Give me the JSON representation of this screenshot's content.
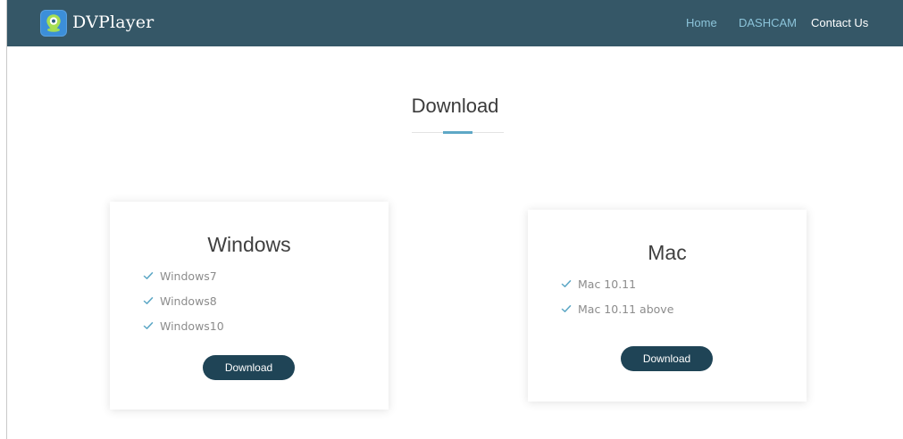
{
  "header": {
    "brand": "DVPlayer",
    "brand_icon": "map-pin-icon",
    "nav": {
      "home": "Home",
      "dashcam": "DASHCAM",
      "contact": "Contact Us"
    }
  },
  "main": {
    "title": "Download"
  },
  "cards": {
    "windows": {
      "title": "Windows",
      "items": [
        "Windows7",
        "Windows8",
        "Windows10"
      ],
      "button_label": "Download"
    },
    "mac": {
      "title": "Mac",
      "items": [
        "Mac 10.11",
        "Mac 10.11 above"
      ],
      "button_label": "Download"
    }
  },
  "colors": {
    "navbar": "#355767",
    "accent": "#5ea8c6",
    "button": "#1f4456",
    "check": "#5ea8c6"
  }
}
